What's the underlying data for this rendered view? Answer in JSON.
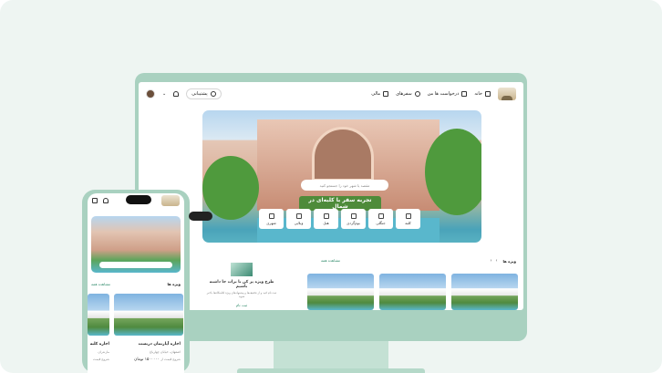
{
  "desktop": {
    "nav": {
      "home": "خانه",
      "requests": "درخواست ها من",
      "trips": "سفرهای",
      "finance": "مالی",
      "support": "پشتیبانی"
    },
    "hero": {
      "title": "تجربه سفر با کلبه‌ای در شمال",
      "search_placeholder": "مقصد یا شهر خود را جستجو کنید"
    },
    "categories": [
      "کلبه",
      "جنگلی",
      "بوم‌گردی",
      "هتل",
      "ویلایی",
      "شهری"
    ],
    "section": {
      "title": "ویژه ها",
      "see_all": "مشاهده همه"
    },
    "promo": {
      "title": "طرح ویژه پر کن تا برات جا داشته باشیم",
      "desc": "ثبت نام کنید و از تخفیف‌ها و پیشنهادهای ویژه اقامتگاه‌ها باخبر شوید",
      "link": "ثبت نام"
    }
  },
  "mobile": {
    "section": {
      "title": "ویژه ها",
      "see_all": "مشاهده همه"
    },
    "card1": {
      "title": "اجاره آپارتمان دربست",
      "location": "اصفهان، خیابان چهارباغ",
      "price": "۱۵۰۰۰۰۰ تومان",
      "price_note": "شروع قیمت از"
    },
    "card2": {
      "title": "اجاره کلبه",
      "location": "مازندران",
      "price_note": "شروع قیمت"
    }
  },
  "colors": {
    "background": "#eef5f2",
    "device": "#a9d1c0",
    "accent": "#2f8a6a"
  }
}
